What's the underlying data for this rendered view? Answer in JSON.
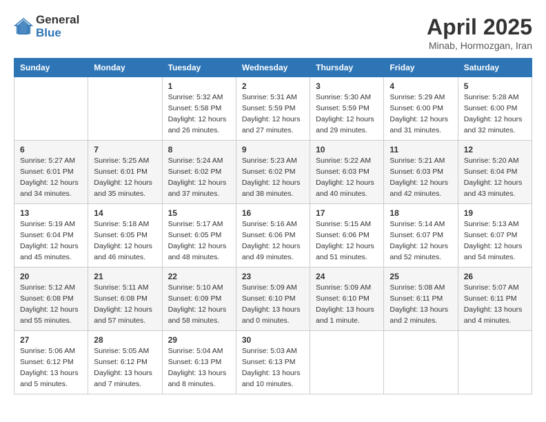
{
  "header": {
    "logo_general": "General",
    "logo_blue": "Blue",
    "month_year": "April 2025",
    "location": "Minab, Hormozgan, Iran"
  },
  "days_of_week": [
    "Sunday",
    "Monday",
    "Tuesday",
    "Wednesday",
    "Thursday",
    "Friday",
    "Saturday"
  ],
  "weeks": [
    [
      {
        "day": "",
        "sunrise": "",
        "sunset": "",
        "daylight": ""
      },
      {
        "day": "",
        "sunrise": "",
        "sunset": "",
        "daylight": ""
      },
      {
        "day": "1",
        "sunrise": "Sunrise: 5:32 AM",
        "sunset": "Sunset: 5:58 PM",
        "daylight": "Daylight: 12 hours and 26 minutes."
      },
      {
        "day": "2",
        "sunrise": "Sunrise: 5:31 AM",
        "sunset": "Sunset: 5:59 PM",
        "daylight": "Daylight: 12 hours and 27 minutes."
      },
      {
        "day": "3",
        "sunrise": "Sunrise: 5:30 AM",
        "sunset": "Sunset: 5:59 PM",
        "daylight": "Daylight: 12 hours and 29 minutes."
      },
      {
        "day": "4",
        "sunrise": "Sunrise: 5:29 AM",
        "sunset": "Sunset: 6:00 PM",
        "daylight": "Daylight: 12 hours and 31 minutes."
      },
      {
        "day": "5",
        "sunrise": "Sunrise: 5:28 AM",
        "sunset": "Sunset: 6:00 PM",
        "daylight": "Daylight: 12 hours and 32 minutes."
      }
    ],
    [
      {
        "day": "6",
        "sunrise": "Sunrise: 5:27 AM",
        "sunset": "Sunset: 6:01 PM",
        "daylight": "Daylight: 12 hours and 34 minutes."
      },
      {
        "day": "7",
        "sunrise": "Sunrise: 5:25 AM",
        "sunset": "Sunset: 6:01 PM",
        "daylight": "Daylight: 12 hours and 35 minutes."
      },
      {
        "day": "8",
        "sunrise": "Sunrise: 5:24 AM",
        "sunset": "Sunset: 6:02 PM",
        "daylight": "Daylight: 12 hours and 37 minutes."
      },
      {
        "day": "9",
        "sunrise": "Sunrise: 5:23 AM",
        "sunset": "Sunset: 6:02 PM",
        "daylight": "Daylight: 12 hours and 38 minutes."
      },
      {
        "day": "10",
        "sunrise": "Sunrise: 5:22 AM",
        "sunset": "Sunset: 6:03 PM",
        "daylight": "Daylight: 12 hours and 40 minutes."
      },
      {
        "day": "11",
        "sunrise": "Sunrise: 5:21 AM",
        "sunset": "Sunset: 6:03 PM",
        "daylight": "Daylight: 12 hours and 42 minutes."
      },
      {
        "day": "12",
        "sunrise": "Sunrise: 5:20 AM",
        "sunset": "Sunset: 6:04 PM",
        "daylight": "Daylight: 12 hours and 43 minutes."
      }
    ],
    [
      {
        "day": "13",
        "sunrise": "Sunrise: 5:19 AM",
        "sunset": "Sunset: 6:04 PM",
        "daylight": "Daylight: 12 hours and 45 minutes."
      },
      {
        "day": "14",
        "sunrise": "Sunrise: 5:18 AM",
        "sunset": "Sunset: 6:05 PM",
        "daylight": "Daylight: 12 hours and 46 minutes."
      },
      {
        "day": "15",
        "sunrise": "Sunrise: 5:17 AM",
        "sunset": "Sunset: 6:05 PM",
        "daylight": "Daylight: 12 hours and 48 minutes."
      },
      {
        "day": "16",
        "sunrise": "Sunrise: 5:16 AM",
        "sunset": "Sunset: 6:06 PM",
        "daylight": "Daylight: 12 hours and 49 minutes."
      },
      {
        "day": "17",
        "sunrise": "Sunrise: 5:15 AM",
        "sunset": "Sunset: 6:06 PM",
        "daylight": "Daylight: 12 hours and 51 minutes."
      },
      {
        "day": "18",
        "sunrise": "Sunrise: 5:14 AM",
        "sunset": "Sunset: 6:07 PM",
        "daylight": "Daylight: 12 hours and 52 minutes."
      },
      {
        "day": "19",
        "sunrise": "Sunrise: 5:13 AM",
        "sunset": "Sunset: 6:07 PM",
        "daylight": "Daylight: 12 hours and 54 minutes."
      }
    ],
    [
      {
        "day": "20",
        "sunrise": "Sunrise: 5:12 AM",
        "sunset": "Sunset: 6:08 PM",
        "daylight": "Daylight: 12 hours and 55 minutes."
      },
      {
        "day": "21",
        "sunrise": "Sunrise: 5:11 AM",
        "sunset": "Sunset: 6:08 PM",
        "daylight": "Daylight: 12 hours and 57 minutes."
      },
      {
        "day": "22",
        "sunrise": "Sunrise: 5:10 AM",
        "sunset": "Sunset: 6:09 PM",
        "daylight": "Daylight: 12 hours and 58 minutes."
      },
      {
        "day": "23",
        "sunrise": "Sunrise: 5:09 AM",
        "sunset": "Sunset: 6:10 PM",
        "daylight": "Daylight: 13 hours and 0 minutes."
      },
      {
        "day": "24",
        "sunrise": "Sunrise: 5:09 AM",
        "sunset": "Sunset: 6:10 PM",
        "daylight": "Daylight: 13 hours and 1 minute."
      },
      {
        "day": "25",
        "sunrise": "Sunrise: 5:08 AM",
        "sunset": "Sunset: 6:11 PM",
        "daylight": "Daylight: 13 hours and 2 minutes."
      },
      {
        "day": "26",
        "sunrise": "Sunrise: 5:07 AM",
        "sunset": "Sunset: 6:11 PM",
        "daylight": "Daylight: 13 hours and 4 minutes."
      }
    ],
    [
      {
        "day": "27",
        "sunrise": "Sunrise: 5:06 AM",
        "sunset": "Sunset: 6:12 PM",
        "daylight": "Daylight: 13 hours and 5 minutes."
      },
      {
        "day": "28",
        "sunrise": "Sunrise: 5:05 AM",
        "sunset": "Sunset: 6:12 PM",
        "daylight": "Daylight: 13 hours and 7 minutes."
      },
      {
        "day": "29",
        "sunrise": "Sunrise: 5:04 AM",
        "sunset": "Sunset: 6:13 PM",
        "daylight": "Daylight: 13 hours and 8 minutes."
      },
      {
        "day": "30",
        "sunrise": "Sunrise: 5:03 AM",
        "sunset": "Sunset: 6:13 PM",
        "daylight": "Daylight: 13 hours and 10 minutes."
      },
      {
        "day": "",
        "sunrise": "",
        "sunset": "",
        "daylight": ""
      },
      {
        "day": "",
        "sunrise": "",
        "sunset": "",
        "daylight": ""
      },
      {
        "day": "",
        "sunrise": "",
        "sunset": "",
        "daylight": ""
      }
    ]
  ]
}
